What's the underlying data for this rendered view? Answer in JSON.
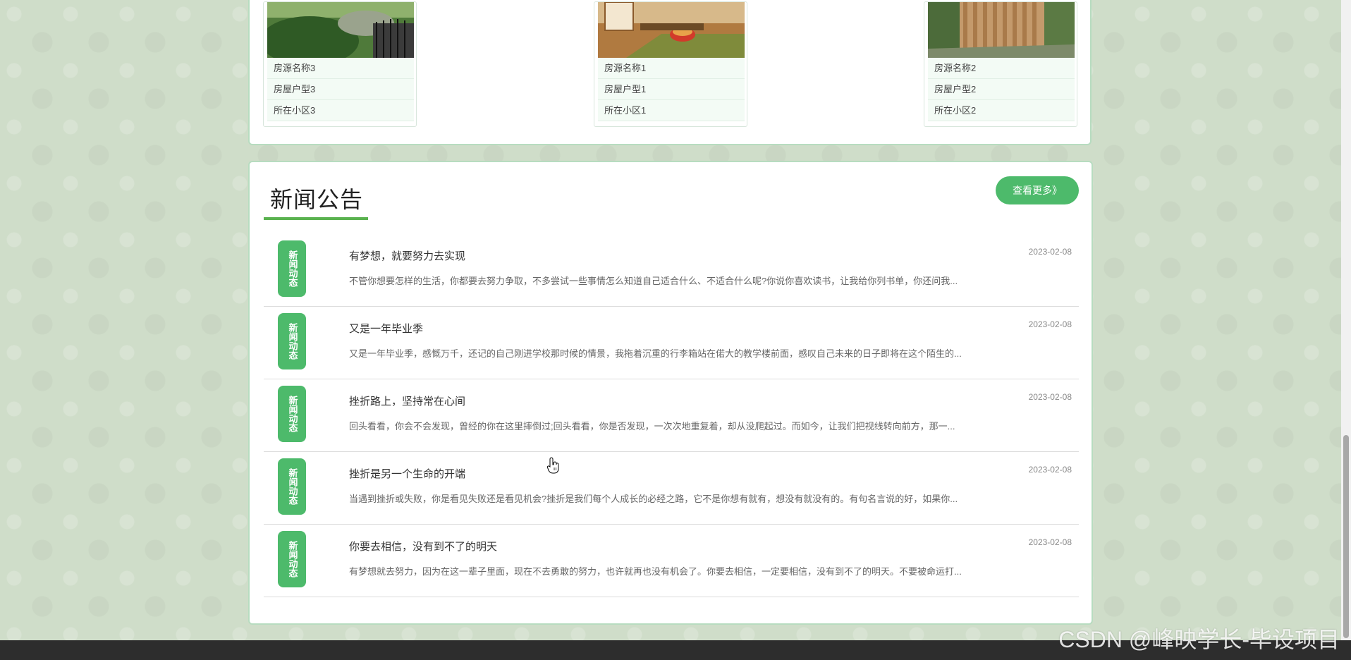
{
  "houses": [
    {
      "name": "房源名称3",
      "type": "房屋户型3",
      "community": "所在小区3"
    },
    {
      "name": "房源名称1",
      "type": "房屋户型1",
      "community": "所在小区1"
    },
    {
      "name": "房源名称2",
      "type": "房屋户型2",
      "community": "所在小区2"
    }
  ],
  "news": {
    "title": "新闻公告",
    "more_label": "查看更多》",
    "items": [
      {
        "badge": "新闻动态",
        "headline": "有梦想，就要努力去实现",
        "summary": "不管你想要怎样的生活，你都要去努力争取，不多尝试一些事情怎么知道自己适合什么、不适合什么呢?你说你喜欢读书，让我给你列书单，你还问我...",
        "date": "2023-02-08"
      },
      {
        "badge": "新闻动态",
        "headline": "又是一年毕业季",
        "summary": "又是一年毕业季，感慨万千，还记的自己刚进学校那时候的情景，我拖着沉重的行李箱站在偌大的教学楼前面，感叹自己未来的日子即将在这个陌生的...",
        "date": "2023-02-08"
      },
      {
        "badge": "新闻动态",
        "headline": "挫折路上，坚持常在心间",
        "summary": "回头看看，你会不会发现，曾经的你在这里摔倒过;回头看看，你是否发现，一次次地重复着，却从没爬起过。而如今，让我们把视线转向前方，那一...",
        "date": "2023-02-08"
      },
      {
        "badge": "新闻动态",
        "headline": "挫折是另一个生命的开端",
        "summary": "当遇到挫折或失败，你是看见失败还是看见机会?挫折是我们每个人成长的必经之路，它不是你想有就有，想没有就没有的。有句名言说的好，如果你...",
        "date": "2023-02-08"
      },
      {
        "badge": "新闻动态",
        "headline": "你要去相信，没有到不了的明天",
        "summary": "有梦想就去努力，因为在这一辈子里面，现在不去勇敢的努力，也许就再也没有机会了。你要去相信，一定要相信，没有到不了的明天。不要被命运打...",
        "date": "2023-02-08"
      }
    ]
  },
  "watermark": "CSDN @峰映学长-毕设项目"
}
